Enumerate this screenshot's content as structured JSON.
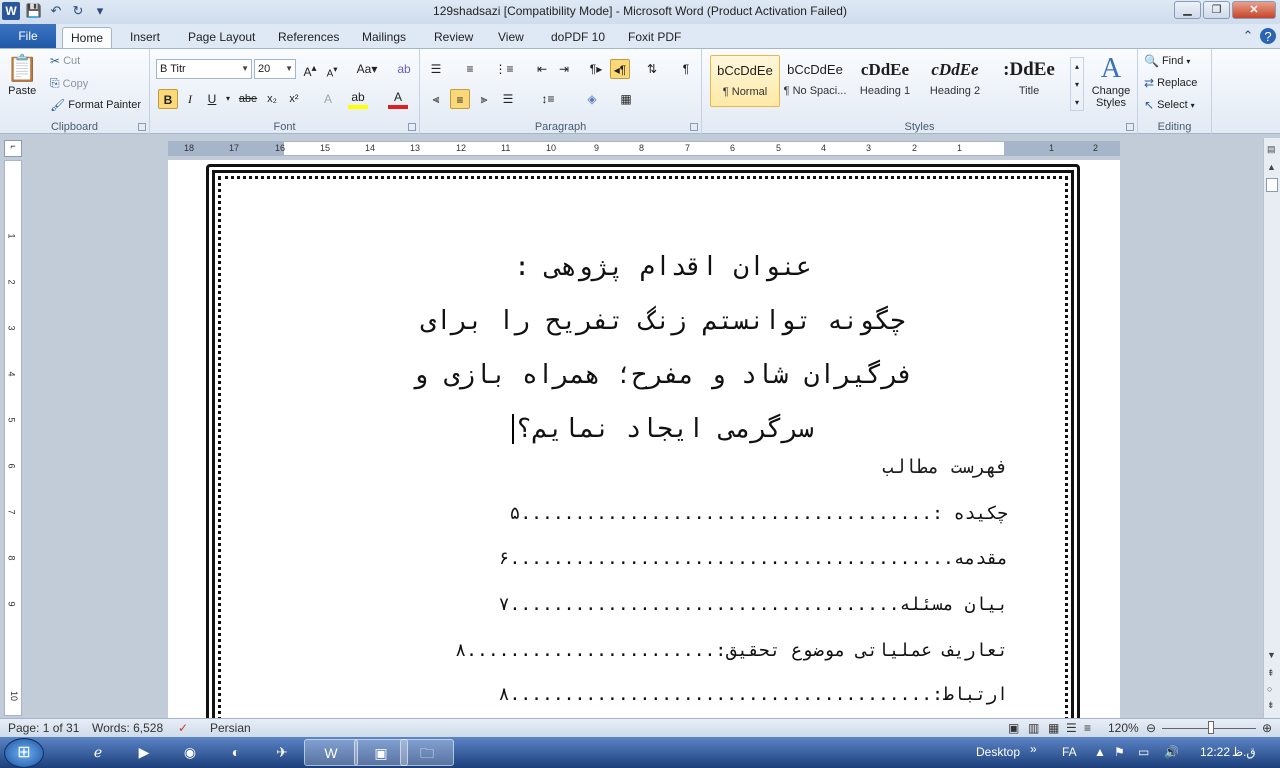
{
  "window": {
    "title": "129shadsazi [Compatibility Mode]  -  Microsoft Word (Product Activation Failed)",
    "app_icon": "W",
    "minimize": "▁",
    "restore": "❐",
    "close": "✕"
  },
  "tabs": [
    "File",
    "Home",
    "Insert",
    "Page Layout",
    "References",
    "Mailings",
    "Review",
    "View",
    "doPDF 10",
    "Foxit PDF"
  ],
  "ribbon": {
    "clipboard": {
      "label": "Clipboard",
      "paste": "Paste",
      "cut": "Cut",
      "copy": "Copy",
      "format_painter": "Format Painter"
    },
    "font": {
      "label": "Font",
      "name": "B Titr",
      "size": "20"
    },
    "paragraph": {
      "label": "Paragraph"
    },
    "styles": {
      "label": "Styles",
      "items": [
        {
          "preview": "bCcDdEe",
          "name": "¶ Normal"
        },
        {
          "preview": "bCcDdEe",
          "name": "¶ No Spaci..."
        },
        {
          "preview": "cDdEe",
          "name": "Heading 1"
        },
        {
          "preview": "cDdEe",
          "name": "Heading 2"
        },
        {
          "preview": ":DdEe",
          "name": "Title"
        }
      ],
      "change_styles": "Change Styles"
    },
    "editing": {
      "label": "Editing",
      "find": "Find",
      "replace": "Replace",
      "select": "Select"
    }
  },
  "ruler": {
    "numbers": [
      "18",
      "17",
      "16",
      "15",
      "14",
      "13",
      "12",
      "11",
      "10",
      "9",
      "8",
      "7",
      "6",
      "5",
      "4",
      "3",
      "2",
      "1",
      "1",
      "2"
    ]
  },
  "vruler": {
    "numbers": [
      "1",
      "2",
      "3",
      "4",
      "5",
      "6",
      "7",
      "8",
      "9",
      "10"
    ]
  },
  "document": {
    "title_lines": [
      "عنوان اقدام پژوهی :",
      "چگونه توانستم زنگ تفریح را برای",
      "فرگیران شاد و مفرح؛ همراه بازی و",
      "سرگرمی ایجاد نمایم؟"
    ],
    "toc_heading": "فهرست مطالب",
    "toc": [
      {
        "entry": "چکیده :......................................",
        "page": "۵"
      },
      {
        "entry": "مقدمه.........................................",
        "page": "۶"
      },
      {
        "entry": "بیان مسئله....................................",
        "page": "۷"
      },
      {
        "entry": "تعاریف عملیاتی موضوع تحقیق:.......................",
        "page": "۸"
      },
      {
        "entry": "ارتباط:.......................................",
        "page": "۸"
      }
    ]
  },
  "status": {
    "page": "Page: 1 of 31",
    "words": "Words: 6,528",
    "language": "Persian",
    "zoom": "120%"
  },
  "taskbar": {
    "desktop": "Desktop",
    "lang": "FA",
    "time": "12:22",
    "ampm": "ق.ظ"
  }
}
